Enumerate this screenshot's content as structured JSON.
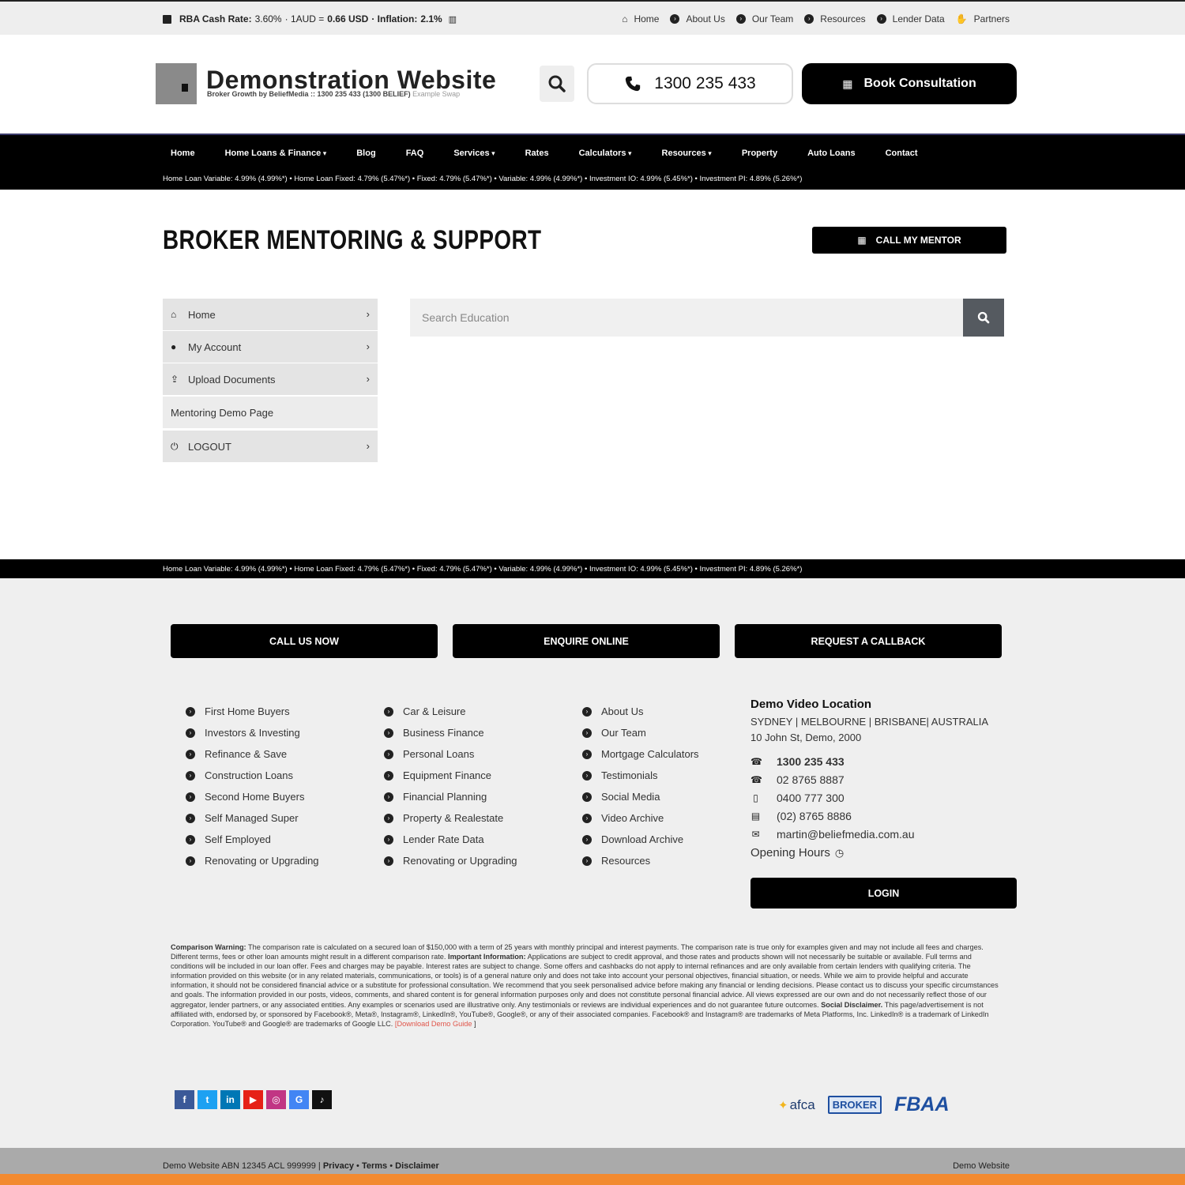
{
  "topbar": {
    "rba_label": "RBA Cash Rate:",
    "rba_value": "3.60%",
    "aud_label": "· 1AUD =",
    "aud_value": "0.66 USD",
    "inflation_label": "· Inflation:",
    "inflation_value": "2.1%",
    "nav": [
      "Home",
      "About Us",
      "Our Team",
      "Resources",
      "Lender Data",
      "Partners"
    ]
  },
  "header": {
    "title": "Demonstration Website",
    "subtitle": "Broker Growth by BeliefMedia :: 1300 235 433 (1300 BELIEF)",
    "subtitle_extra": "Example Swap",
    "phone": "1300 235 433",
    "book_label": "Book Consultation"
  },
  "mainnav": {
    "items": [
      "Home",
      "Home Loans & Finance",
      "Blog",
      "FAQ",
      "Services",
      "Rates",
      "Calculators",
      "Resources",
      "Property",
      "Auto Loans",
      "Contact"
    ],
    "ticker": "Home Loan Variable: 4.99% (4.99%*) • Home Loan Fixed: 4.79% (5.47%*) • Fixed: 4.79% (5.47%*) • Variable: 4.99% (4.99%*) • Investment IO: 4.99% (5.45%*) • Investment PI: 4.89% (5.26%*)"
  },
  "page": {
    "title": "BROKER MENTORING & SUPPORT",
    "mentor_button": "CALL MY MENTOR"
  },
  "sidebar": {
    "items": [
      "Home",
      "My Account",
      "Upload Documents",
      "Mentoring Demo Page",
      "LOGOUT"
    ]
  },
  "search": {
    "placeholder": "Search Education"
  },
  "ticker2": "Home Loan Variable: 4.99% (4.99%*) • Home Loan Fixed: 4.79% (5.47%*) • Fixed: 4.79% (5.47%*) • Variable: 4.99% (4.99%*) • Investment IO: 4.99% (5.45%*) • Investment PI: 4.89% (5.26%*)",
  "footer": {
    "cta": [
      "CALL US NOW",
      "ENQUIRE ONLINE",
      "REQUEST A CALLBACK"
    ],
    "col1": [
      "First Home Buyers",
      "Investors & Investing",
      "Refinance & Save",
      "Construction Loans",
      "Second Home Buyers",
      "Self Managed Super",
      "Self Employed",
      "Renovating or Upgrading"
    ],
    "col2": [
      "Car & Leisure",
      "Business Finance",
      "Personal Loans",
      "Equipment Finance",
      "Financial Planning",
      "Property & Realestate",
      "Lender Rate Data",
      "Renovating or Upgrading"
    ],
    "col3": [
      "About Us",
      "Our Team",
      "Mortgage Calculators",
      "Testimonials",
      "Social Media",
      "Video Archive",
      "Download Archive",
      "Resources"
    ],
    "contact": {
      "title": "Demo Video Location",
      "cities": "SYDNEY | MELBOURNE | BRISBANE| AUSTRALIA",
      "address": "10 John St, Demo, 2000",
      "phone1": "1300 235 433",
      "phone2": "02 8765 8887",
      "mobile": "0400 777 300",
      "fax": "(02) 8765 8886",
      "email": "martin@beliefmedia.com.au",
      "hours": "Opening Hours"
    },
    "login": "LOGIN",
    "disclaimer": {
      "warning_label": "Comparison Warning:",
      "warning_text": "The comparison rate is calculated on a secured loan of $150,000 with a term of 25 years with monthly principal and interest payments. The comparison rate is true only for examples given and may not include all fees and charges. Different terms, fees or other loan amounts might result in a different comparison rate.",
      "important_label": "Important Information:",
      "important_text": "Applications are subject to credit approval, and those rates and products shown will not necessarily be suitable or available. Full terms and conditions will be included in our loan offer. Fees and charges may be payable. Interest rates are subject to change. Some offers and cashbacks do not apply to internal refinances and are only available from certain lenders with qualifying criteria. The information provided on this website (or in any related materials, communications, or tools) is of a general nature only and does not take into account your personal objectives, financial situation, or needs. While we aim to provide helpful and accurate information, it should not be considered financial advice or a substitute for professional consultation. We recommend that you seek personalised advice before making any financial or lending decisions. Please contact us to discuss your specific circumstances and goals. The information provided in our posts, videos, comments, and shared content is for general information purposes only and does not constitute personal financial advice. All views expressed are our own and do not necessarily reflect those of our aggregator, lender partners, or any associated entities. Any examples or scenarios used are illustrative only. Any testimonials or reviews are individual experiences and do not guarantee future outcomes.",
      "social_label": "Social Disclaimer.",
      "social_text": "This page/advertisement is not affiliated with, endorsed by, or sponsored by Facebook®, Meta®, Instagram®, LinkedIn®, YouTube®, Google®, or any of their associated companies. Facebook® and Instagram® are trademarks of Meta Platforms, Inc. LinkedIn® is a trademark of LinkedIn Corporation. YouTube® and Google® are trademarks of Google LLC.",
      "open": "[",
      "link": "Download Demo Guide",
      "close": "]"
    },
    "socials": [
      "f",
      "t",
      "in",
      "▶",
      "◎",
      "G",
      "♪"
    ],
    "badges": {
      "afca": "afca",
      "broker": "BROKER",
      "fbaa": "FBAA"
    }
  },
  "bottom": {
    "left": "Demo Website ABN 12345 ACL 999999 |",
    "privacy": "Privacy",
    "terms": "Terms",
    "disclaimer": "Disclaimer",
    "right": "Demo Website"
  },
  "colors": {
    "black": "#000000",
    "footer_bg": "#efefef",
    "bottom_bar": "#aaaaaa",
    "accent_orange": "#f28a30",
    "link_red": "#e0554a"
  }
}
